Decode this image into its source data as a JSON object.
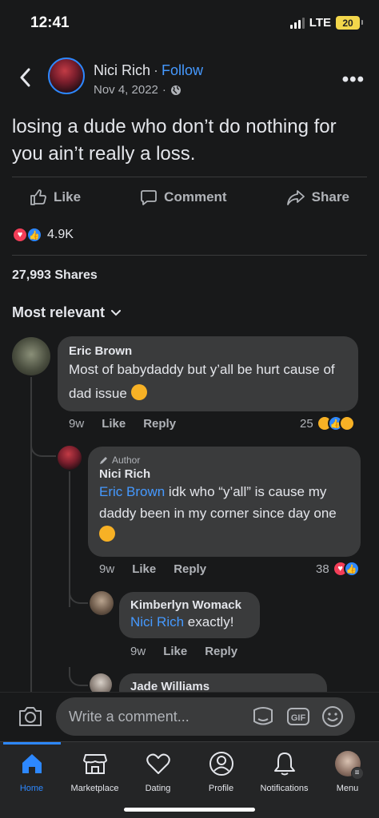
{
  "status": {
    "time": "12:41",
    "network": "LTE",
    "battery": "20"
  },
  "post": {
    "author": "Nici Rich",
    "follow_label": "Follow",
    "date": "Nov 4, 2022",
    "privacy_icon": "globe-icon",
    "text": "losing a dude who don’t do nothing for you ain’t really a loss.",
    "actions": {
      "like": "Like",
      "comment": "Comment",
      "share": "Share"
    },
    "reactions_count": "4.9K",
    "shares": "27,993 Shares"
  },
  "sort_label": "Most relevant",
  "comments": [
    {
      "name": "Eric Brown",
      "text": "Most of babydaddy but y’all be hurt cause of dad issue",
      "time": "9w",
      "like": "Like",
      "reply": "Reply",
      "reaction_count": "25"
    },
    {
      "badge": "Author",
      "name": "Nici Rich",
      "mention": "Eric Brown",
      "text_line1": "idk who “y’all” is cause my",
      "text_rest": "daddy been in my corner since day one",
      "time": "9w",
      "like": "Like",
      "reply": "Reply",
      "reaction_count": "38"
    },
    {
      "name": "Kimberlyn Womack",
      "mention": "Nici Rich",
      "text": "exactly!",
      "time": "9w",
      "like": "Like",
      "reply": "Reply"
    },
    {
      "name": "Jade Williams"
    }
  ],
  "composer": {
    "placeholder": "Write a comment..."
  },
  "tabs": [
    {
      "label": "Home",
      "icon": "home-icon"
    },
    {
      "label": "Marketplace",
      "icon": "marketplace-icon"
    },
    {
      "label": "Dating",
      "icon": "dating-icon"
    },
    {
      "label": "Profile",
      "icon": "profile-icon"
    },
    {
      "label": "Notifications",
      "icon": "bell-icon"
    },
    {
      "label": "Menu",
      "icon": "menu-avatar"
    }
  ],
  "colors": {
    "accent": "#2d88ff",
    "background": "#18191a",
    "bubble": "#3a3b3c",
    "heart": "#f33e58"
  }
}
